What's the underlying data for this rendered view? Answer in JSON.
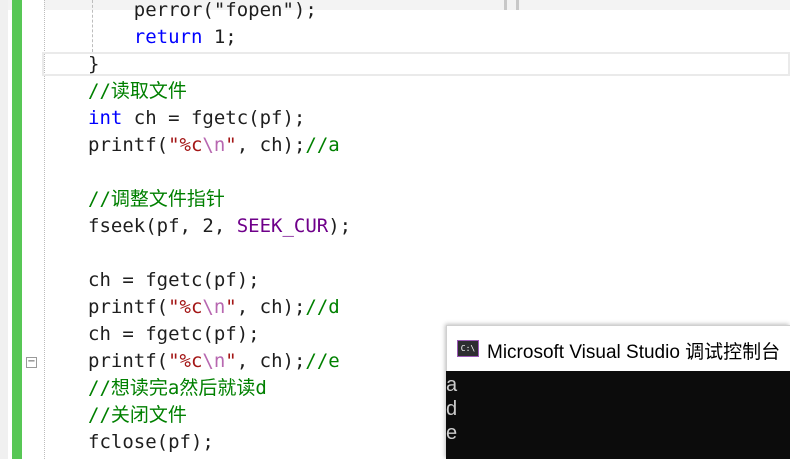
{
  "editor": {
    "collapse_glyph": "−",
    "lines": [
      {
        "segments": [
          {
            "t": "    perror(\"fopen\");",
            "c": "plain"
          }
        ]
      },
      {
        "segments": [
          {
            "t": "    ",
            "c": "plain"
          },
          {
            "t": "return",
            "c": "kw"
          },
          {
            "t": " 1;",
            "c": "plain"
          }
        ]
      },
      {
        "segments": [
          {
            "t": "}",
            "c": "plain"
          }
        ]
      },
      {
        "segments": [
          {
            "t": "//读取文件",
            "c": "cm"
          }
        ]
      },
      {
        "segments": [
          {
            "t": "int",
            "c": "kw"
          },
          {
            "t": " ch = fgetc(pf);",
            "c": "plain"
          }
        ]
      },
      {
        "segments": [
          {
            "t": "printf(",
            "c": "plain"
          },
          {
            "t": "\"%c",
            "c": "st"
          },
          {
            "t": "\\n",
            "c": "esc"
          },
          {
            "t": "\"",
            "c": "st"
          },
          {
            "t": ", ch);",
            "c": "plain"
          },
          {
            "t": "//a",
            "c": "cm"
          }
        ]
      },
      {
        "segments": []
      },
      {
        "segments": [
          {
            "t": "//调整文件指针",
            "c": "cm"
          }
        ]
      },
      {
        "segments": [
          {
            "t": "fseek(pf, 2, ",
            "c": "plain"
          },
          {
            "t": "SEEK_CUR",
            "c": "mac"
          },
          {
            "t": ");",
            "c": "plain"
          }
        ]
      },
      {
        "segments": []
      },
      {
        "segments": [
          {
            "t": "ch = fgetc(pf);",
            "c": "plain"
          }
        ]
      },
      {
        "segments": [
          {
            "t": "printf(",
            "c": "plain"
          },
          {
            "t": "\"%c",
            "c": "st"
          },
          {
            "t": "\\n",
            "c": "esc"
          },
          {
            "t": "\"",
            "c": "st"
          },
          {
            "t": ", ch);",
            "c": "plain"
          },
          {
            "t": "//d",
            "c": "cm"
          }
        ]
      },
      {
        "segments": [
          {
            "t": "ch = fgetc(pf);",
            "c": "plain"
          }
        ]
      },
      {
        "segments": [
          {
            "t": "printf(",
            "c": "plain"
          },
          {
            "t": "\"%c",
            "c": "st"
          },
          {
            "t": "\\n",
            "c": "esc"
          },
          {
            "t": "\"",
            "c": "st"
          },
          {
            "t": ", ch);",
            "c": "plain"
          },
          {
            "t": "//e",
            "c": "cm"
          }
        ]
      },
      {
        "segments": [
          {
            "t": "//想读完a然后就读d",
            "c": "cm"
          }
        ]
      },
      {
        "segments": [
          {
            "t": "//关闭文件",
            "c": "cm"
          }
        ]
      },
      {
        "segments": [
          {
            "t": "fclose(pf);",
            "c": "plain"
          }
        ]
      }
    ]
  },
  "console": {
    "icon_label": "C:\\",
    "icon_name": "console-app-icon",
    "title": "Microsoft Visual Studio 调试控制台",
    "output": [
      "a",
      "d",
      "e"
    ]
  },
  "colors": {
    "keyword": "#0000ff",
    "comment": "#008000",
    "string": "#a31515",
    "macro": "#6f008a",
    "change_bar": "#57c755",
    "console_bg": "#0c0c0c"
  }
}
